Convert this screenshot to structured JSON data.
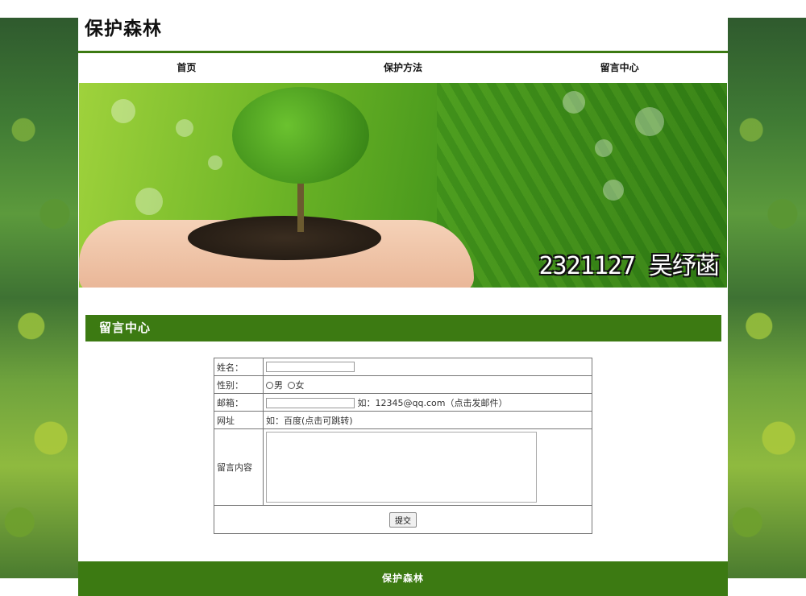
{
  "site": {
    "title": "保护森林"
  },
  "nav": {
    "items": [
      {
        "label": "首页"
      },
      {
        "label": "保护方法"
      },
      {
        "label": "留言中心"
      }
    ]
  },
  "banner": {
    "caption": "2321127 吴纾菡"
  },
  "section": {
    "title": "留言中心"
  },
  "form": {
    "name_label": "姓名：",
    "gender_label": "性别：",
    "gender_options": [
      "男",
      "女"
    ],
    "email_label": "邮箱：",
    "email_hint": "如：12345@qq.com（点击发邮件）",
    "website_label": "网址",
    "website_hint": "如：百度(点击可跳转)",
    "message_label": "留言内容",
    "submit_label": "提交"
  },
  "footer": {
    "text": "保护森林"
  },
  "colors": {
    "accent_green": "#3c7a12"
  }
}
